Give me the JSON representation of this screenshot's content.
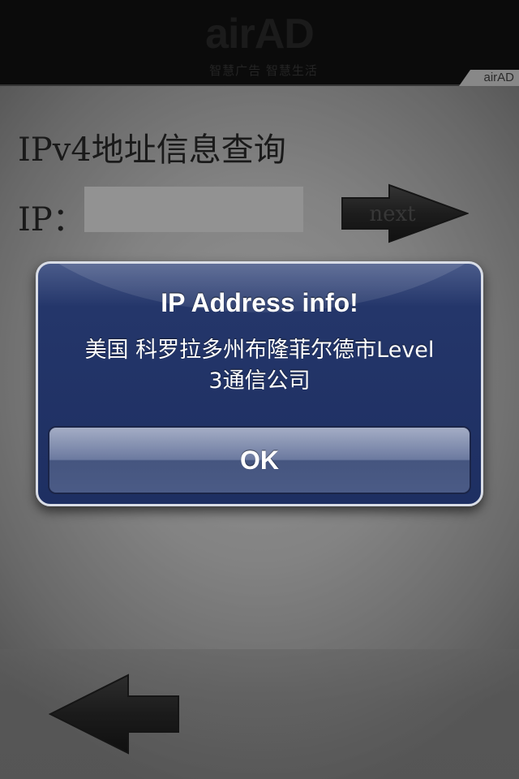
{
  "ad_banner": {
    "logo": "airAD",
    "slogan": "智慧广告 智慧生活",
    "tag": "airAD"
  },
  "main": {
    "title": "IPv4地址信息查询",
    "ip_label": "IP：",
    "ip_input": {
      "value": "",
      "placeholder": ""
    },
    "next_button_label": "next",
    "back_button_icon": "left-arrow-icon"
  },
  "alert": {
    "title": "IP Address info!",
    "message_line1": "美国 科罗拉多州布隆菲尔德市Level",
    "message_line2": "3通信公司",
    "ok_label": "OK"
  },
  "colors": {
    "ad_background": "#131313",
    "alert_background": "#1e2f62",
    "alert_border": "#d9dde6",
    "arrow": "#3a3a3a"
  }
}
